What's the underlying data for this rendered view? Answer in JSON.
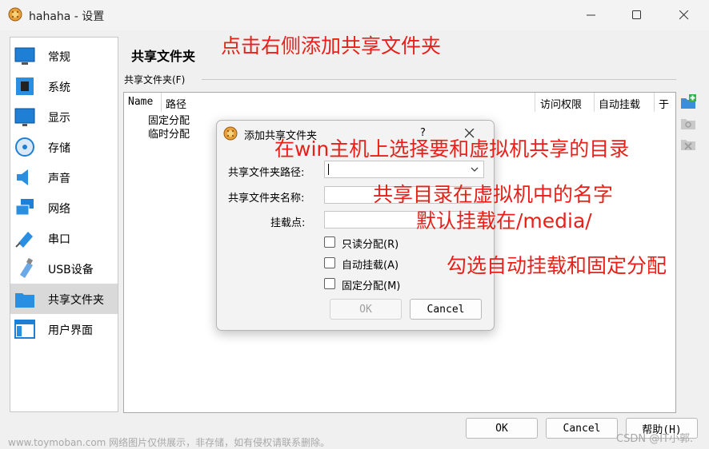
{
  "window": {
    "title": "hahaha - 设置"
  },
  "sidebar": {
    "items": [
      {
        "label": "常规"
      },
      {
        "label": "系统"
      },
      {
        "label": "显示"
      },
      {
        "label": "存储"
      },
      {
        "label": "声音"
      },
      {
        "label": "网络"
      },
      {
        "label": "串口"
      },
      {
        "label": "USB设备"
      },
      {
        "label": "共享文件夹"
      },
      {
        "label": "用户界面"
      }
    ],
    "selected": "共享文件夹"
  },
  "main": {
    "title": "共享文件夹",
    "group_label": "共享文件夹(F)",
    "table": {
      "columns": [
        "Name",
        "路径",
        "访问权限",
        "自动挂载",
        "于"
      ],
      "rows": [
        "固定分配",
        "临时分配"
      ]
    }
  },
  "dialog": {
    "title": "添加共享文件夹",
    "help": "?",
    "path_label": "共享文件夹路径:",
    "path_value": "",
    "name_label": "共享文件夹名称:",
    "name_value": "",
    "mount_label": "挂载点:",
    "mount_value": "",
    "readonly_label": "只读分配(R)",
    "automount_label": "自动挂载(A)",
    "permanent_label": "固定分配(M)",
    "ok_label": "OK",
    "cancel_label": "Cancel"
  },
  "buttons": {
    "ok": "OK",
    "cancel": "Cancel",
    "help": "帮助(H)"
  },
  "annotations": {
    "a1": "点击右侧添加共享文件夹",
    "a2": "在win主机上选择要和虚拟机共享的目录",
    "a3": "共享目录在虚拟机中的名字",
    "a4": "默认挂载在/media/",
    "a5": "勾选自动挂载和固定分配"
  },
  "watermarks": {
    "left": "www.toymoban.com 网络图片仅供展示，非存储，如有侵权请联系删除。",
    "right": "CSDN @IT小郭."
  },
  "colors": {
    "annotation": "#e8201a",
    "selection": "#d9d9d9",
    "accent": "#0a64c8"
  }
}
